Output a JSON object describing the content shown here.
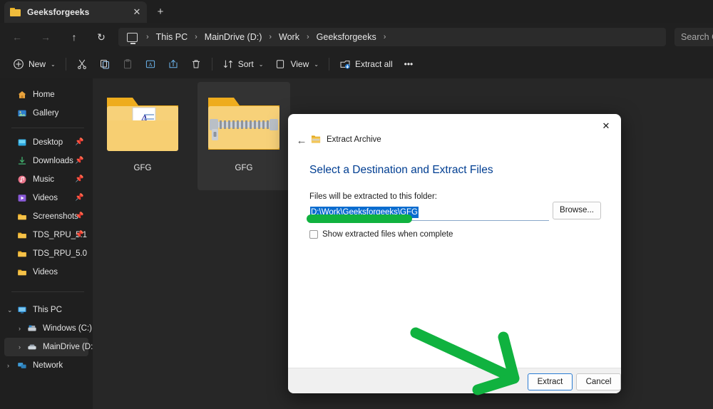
{
  "window": {
    "tab": {
      "title": "Geeksforgeeks",
      "folder_icon": "folder-icon",
      "close_icon": "✕"
    },
    "new_tab_icon": "+"
  },
  "nav": {
    "back_icon": "←",
    "forward_icon": "→",
    "up_icon": "↑",
    "refresh_icon": "↻",
    "breadcrumb": [
      "This PC",
      "MainDrive (D:)",
      "Work",
      "Geeksforgeeks"
    ],
    "separator": "›",
    "monitor_icon": "this-pc-icon"
  },
  "search": {
    "text": "Search G"
  },
  "toolbar": {
    "new_label": "New",
    "new_icon": "plus-circle-icon",
    "cut_icon": "scissors-icon",
    "copy_icon": "copy-icon",
    "paste_icon": "paste-icon",
    "rename_icon": "rename-icon",
    "share_icon": "share-icon",
    "delete_icon": "trash-icon",
    "sort_label": "Sort",
    "sort_icon": "sort-icon",
    "view_label": "View",
    "view_icon": "view-icon",
    "extract_all_label": "Extract all",
    "extract_all_icon": "extract-icon",
    "more_label": "•••",
    "chevron": "⌄"
  },
  "sidebar": {
    "top_items": [
      {
        "label": "Home",
        "icon": "home-icon",
        "pinned": false
      },
      {
        "label": "Gallery",
        "icon": "gallery-icon",
        "pinned": false
      }
    ],
    "quick_items": [
      {
        "label": "Desktop",
        "icon": "desktop-icon",
        "pinned": true
      },
      {
        "label": "Downloads",
        "icon": "downloads-icon",
        "pinned": true
      },
      {
        "label": "Music",
        "icon": "music-icon",
        "pinned": true
      },
      {
        "label": "Videos",
        "icon": "videos-icon",
        "pinned": true
      },
      {
        "label": "Screenshots",
        "icon": "folder-icon",
        "pinned": true
      },
      {
        "label": "TDS_RPU_5.1",
        "icon": "folder-icon",
        "pinned": true
      },
      {
        "label": "TDS_RPU_5.0",
        "icon": "folder-icon",
        "pinned": false
      },
      {
        "label": "Videos",
        "icon": "folder-icon",
        "pinned": false
      }
    ],
    "tree_items": [
      {
        "label": "This PC",
        "icon": "pc-icon",
        "expander": "⌄",
        "expanded": true,
        "indent": 0,
        "selected": false
      },
      {
        "label": "Windows (C:)",
        "icon": "drive-windows-icon",
        "expander": "›",
        "expanded": false,
        "indent": 1,
        "selected": false
      },
      {
        "label": "MainDrive (D:)",
        "icon": "drive-icon",
        "expander": "›",
        "expanded": false,
        "indent": 1,
        "selected": true
      },
      {
        "label": "Network",
        "icon": "network-icon",
        "expander": "›",
        "expanded": false,
        "indent": 0,
        "selected": false
      }
    ]
  },
  "files": [
    {
      "name": "GFG",
      "type": "folder",
      "selected": false
    },
    {
      "name": "GFG",
      "type": "zip-folder",
      "selected": true
    }
  ],
  "dialog": {
    "close_icon": "✕",
    "back_icon": "←",
    "crumb_label": "Extract Archive",
    "crumb_icon": "zip-folder-icon",
    "heading": "Select a Destination and Extract Files",
    "path_label": "Files will be extracted to this folder:",
    "path_value": "D:\\Work\\Geeksforgeeks\\GFG",
    "browse_label": "Browse...",
    "checkbox_label": "Show extracted files when complete",
    "checkbox_checked": false,
    "extract_label": "Extract",
    "cancel_label": "Cancel"
  },
  "annotations": {
    "highlight_color": "#10b23f",
    "underline": "path-underline",
    "arrow": "arrow-to-extract-button"
  }
}
